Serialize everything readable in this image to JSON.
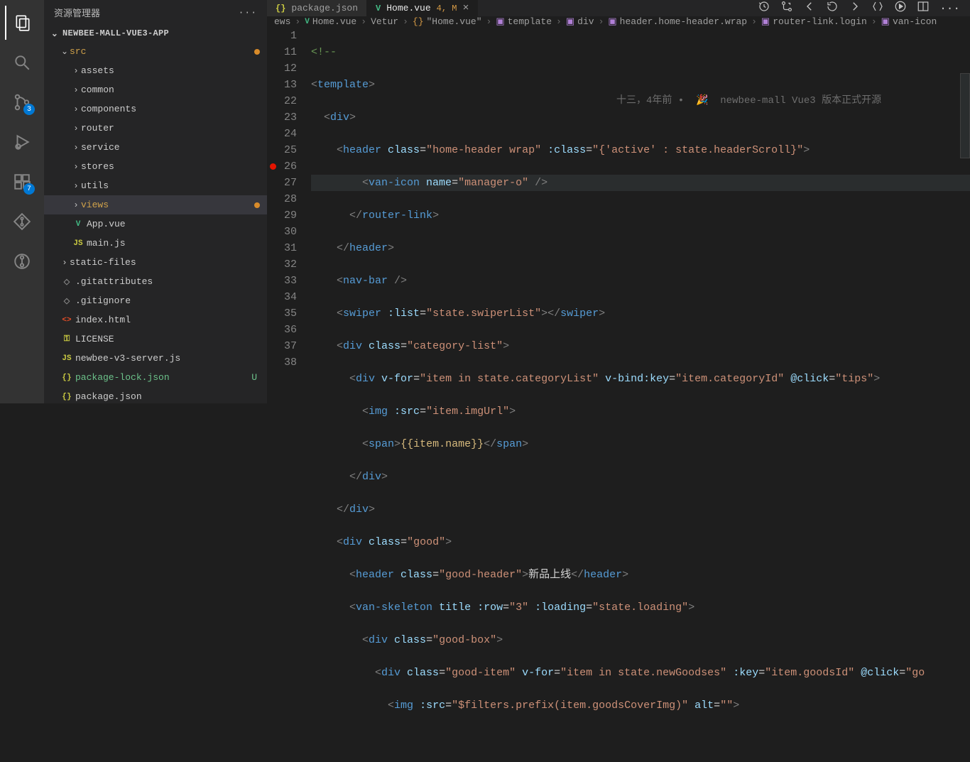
{
  "sidebar": {
    "title": "资源管理器",
    "root": "NEWBEE-MALL-VUE3-APP",
    "src": "src",
    "folders": [
      "assets",
      "common",
      "components",
      "router",
      "service",
      "stores",
      "utils",
      "views"
    ],
    "files_in_src": [
      {
        "icon": "vue",
        "label": "App.vue"
      },
      {
        "icon": "js",
        "label": "main.js"
      }
    ],
    "root_files": [
      {
        "icon": "folder",
        "label": "static-files",
        "chev": true
      },
      {
        "icon": "gray",
        "label": ".gitattributes"
      },
      {
        "icon": "gray",
        "label": ".gitignore"
      },
      {
        "icon": "html",
        "label": "index.html"
      },
      {
        "icon": "key",
        "label": "LICENSE"
      },
      {
        "icon": "js",
        "label": "newbee-v3-server.js"
      },
      {
        "icon": "json",
        "label": "package-lock.json",
        "green": true,
        "status": "U"
      },
      {
        "icon": "json",
        "label": "package.json"
      }
    ]
  },
  "activitybar": {
    "scm_badge": "3",
    "ext_badge": "7"
  },
  "tabs": [
    {
      "icon": "json",
      "label": "package.json",
      "active": false
    },
    {
      "icon": "vue",
      "label": "Home.vue",
      "mods": "4, M",
      "active": true
    }
  ],
  "breadcrumbs": [
    {
      "label": "ews",
      "icon": ""
    },
    {
      "label": "Home.vue",
      "icon": "vue"
    },
    {
      "label": "Vetur",
      "icon": ""
    },
    {
      "label": "\"Home.vue\"",
      "icon": "braces"
    },
    {
      "label": "template",
      "icon": "cube-p"
    },
    {
      "label": "div",
      "icon": "cube-p"
    },
    {
      "label": "header.home-header.wrap",
      "icon": "cube-p"
    },
    {
      "label": "router-link.login",
      "icon": "cube-p"
    },
    {
      "label": "van-icon",
      "icon": "cube-p"
    }
  ],
  "code": {
    "line_numbers": [
      "1",
      "11",
      "12",
      "13",
      "22",
      "23",
      "24",
      "25",
      "26",
      "27",
      "28",
      "29",
      "30",
      "31",
      "32",
      "33",
      "34",
      "35",
      "36",
      "37",
      "38",
      ""
    ],
    "blame": "十三，4年前 •  🎉  newbee-mall Vue3 版本正式开源"
  },
  "codelines": {
    "l1": "<!--",
    "l11_a": "<",
    "l11_b": "template",
    "l11_c": ">",
    "l12_a": "<",
    "l12_b": "div",
    "l12_c": ">",
    "l13_a": "<",
    "l13_b": "header",
    "l13_c": " class",
    "l13_d": "=",
    "l13_e": "\"home-header wrap\"",
    "l13_f": " :class",
    "l13_g": "=",
    "l13_h": "\"{'active' : state.headerScroll}\"",
    "l13_i": ">",
    "l22_a": "<",
    "l22_b": "van-icon",
    "l22_c": " name",
    "l22_d": "=",
    "l22_e": "\"manager-o\"",
    "l22_f": " />",
    "l23_a": "</",
    "l23_b": "router-link",
    "l23_c": ">",
    "l24_a": "</",
    "l24_b": "header",
    "l24_c": ">",
    "l25_a": "<",
    "l25_b": "nav-bar",
    "l25_c": " />",
    "l26_a": "<",
    "l26_b": "swiper",
    "l26_c": " :list",
    "l26_d": "=",
    "l26_e": "\"state.swiperList\"",
    "l26_f": "></",
    "l26_g": "swiper",
    "l26_h": ">",
    "l27_a": "<",
    "l27_b": "div",
    "l27_c": " class",
    "l27_d": "=",
    "l27_e": "\"category-list\"",
    "l27_f": ">",
    "l28_a": "<",
    "l28_b": "div",
    "l28_c": " v-for",
    "l28_d": "=",
    "l28_e": "\"item in state.categoryList\"",
    "l28_f": " v-bind:key",
    "l28_g": "=",
    "l28_h": "\"item.categoryId\"",
    "l28_i": " @click",
    "l28_j": "=",
    "l28_k": "\"tips\"",
    "l28_l": ">",
    "l29_a": "<",
    "l29_b": "img",
    "l29_c": " :src",
    "l29_d": "=",
    "l29_e": "\"item.imgUrl\"",
    "l29_f": ">",
    "l30_a": "<",
    "l30_b": "span",
    "l30_c": ">",
    "l30_d": "{{item.name}}",
    "l30_e": "</",
    "l30_f": "span",
    "l30_g": ">",
    "l31_a": "</",
    "l31_b": "div",
    "l31_c": ">",
    "l32_a": "</",
    "l32_b": "div",
    "l32_c": ">",
    "l33_a": "<",
    "l33_b": "div",
    "l33_c": " class",
    "l33_d": "=",
    "l33_e": "\"good\"",
    "l33_f": ">",
    "l34_a": "<",
    "l34_b": "header",
    "l34_c": " class",
    "l34_d": "=",
    "l34_e": "\"good-header\"",
    "l34_f": ">",
    "l34_g": "新品上线",
    "l34_h": "</",
    "l34_i": "header",
    "l34_j": ">",
    "l35_a": "<",
    "l35_b": "van-skeleton",
    "l35_c": " title :row",
    "l35_d": "=",
    "l35_e": "\"3\"",
    "l35_f": " :loading",
    "l35_g": "=",
    "l35_h": "\"state.loading\"",
    "l35_i": ">",
    "l36_a": "<",
    "l36_b": "div",
    "l36_c": " class",
    "l36_d": "=",
    "l36_e": "\"good-box\"",
    "l36_f": ">",
    "l37_a": "<",
    "l37_b": "div",
    "l37_c": " class",
    "l37_d": "=",
    "l37_e": "\"good-item\"",
    "l37_f": " v-for",
    "l37_g": "=",
    "l37_h": "\"item in state.newGoodses\"",
    "l37_i": " :key",
    "l37_j": "=",
    "l37_k": "\"item.goodsId\"",
    "l37_l": " @click",
    "l37_m": "=",
    "l37_n": "\"go",
    "l37_extra": "",
    "l38_a": "<",
    "l38_b": "img",
    "l38_c": " :src",
    "l38_d": "=",
    "l38_e": "\"$filters.prefix(item.goodsCoverImg)\"",
    "l38_f": " alt",
    "l38_g": "=",
    "l38_h": "\"\"",
    "l38_i": ">"
  }
}
